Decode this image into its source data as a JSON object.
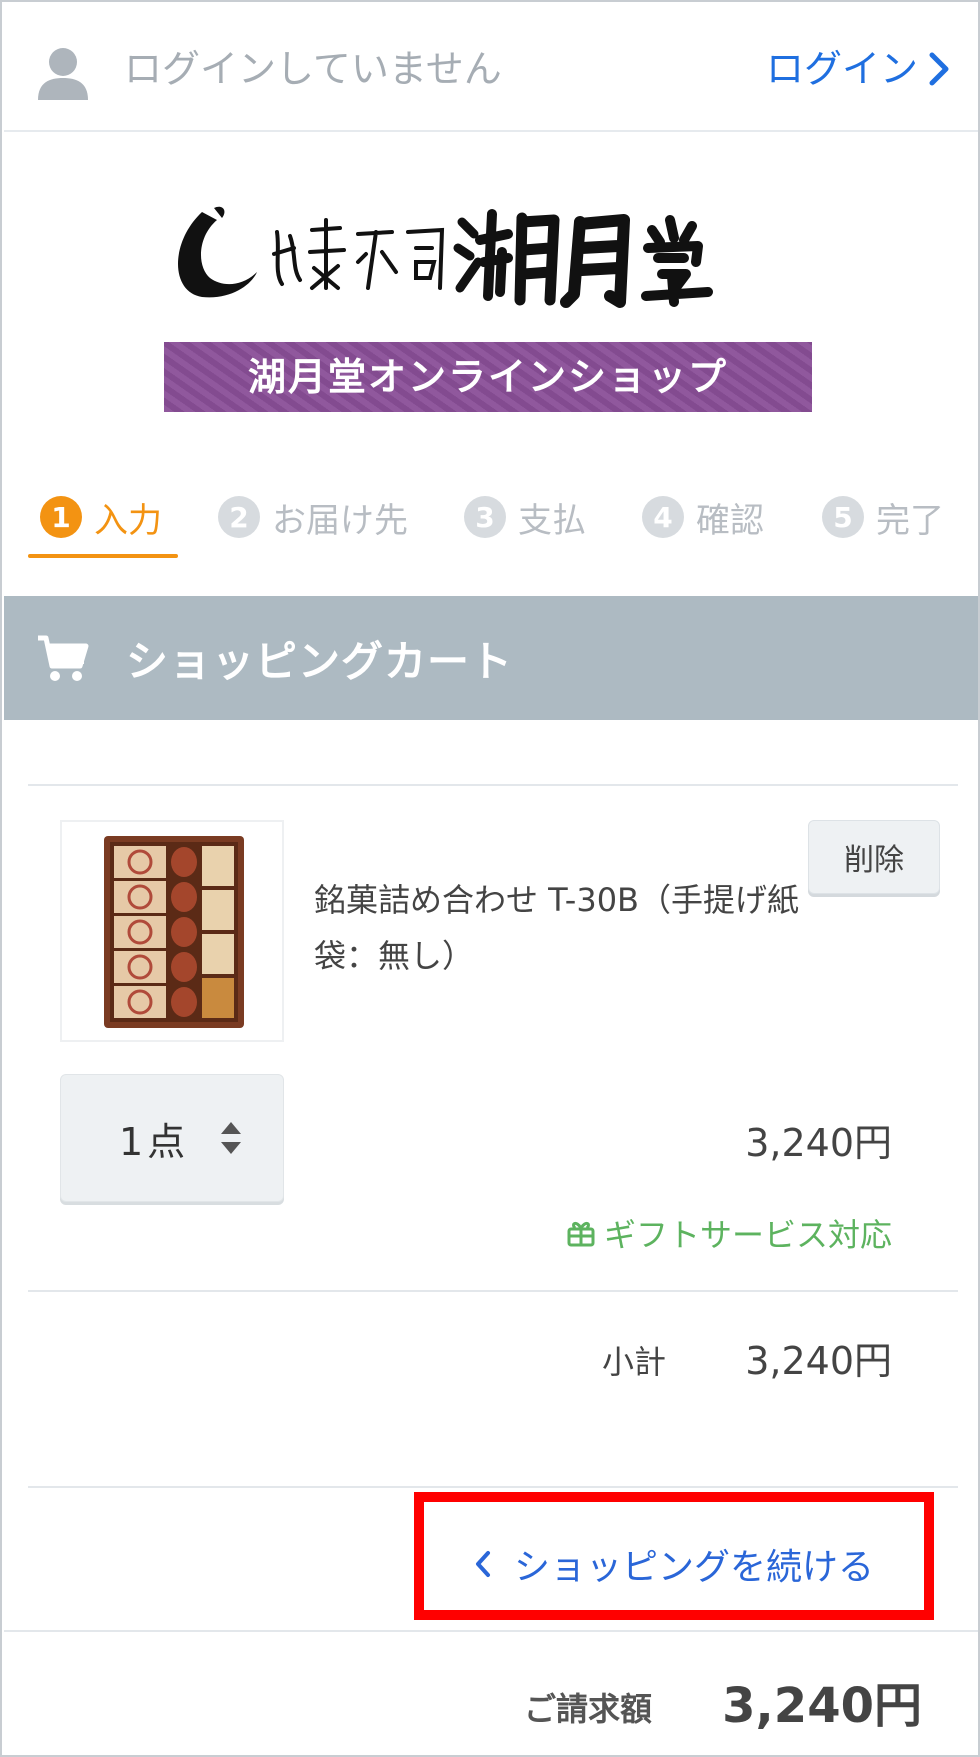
{
  "header": {
    "login_status": "ログインしていません",
    "login_link": "ログイン"
  },
  "logo": {
    "brand_text": "お菓子司 湖月堂",
    "banner": "湖月堂オンラインショップ"
  },
  "steps": [
    {
      "num": "1",
      "label": "入力",
      "active": true
    },
    {
      "num": "2",
      "label": "お届け先",
      "active": false
    },
    {
      "num": "3",
      "label": "支払",
      "active": false
    },
    {
      "num": "4",
      "label": "確認",
      "active": false
    },
    {
      "num": "5",
      "label": "完了",
      "active": false
    }
  ],
  "cart": {
    "title": "ショッピングカート",
    "item": {
      "name": "銘菓詰め合わせ T-30B（手提げ紙袋：無し）",
      "delete_label": "削除",
      "quantity": "1点",
      "price": "3,240円",
      "gift": "ギフトサービス対応"
    },
    "subtotal_label": "小計",
    "subtotal_value": "3,240円",
    "continue_label": "ショッピングを続ける"
  },
  "footer": {
    "total_label": "ご請求額",
    "total_value": "3,240円"
  },
  "colors": {
    "accent": "#f39312",
    "link": "#1f6fe0",
    "cart_header": "#adbac2",
    "banner": "#8a4f98",
    "gift": "#5db35f",
    "highlight": "#ff0000"
  }
}
